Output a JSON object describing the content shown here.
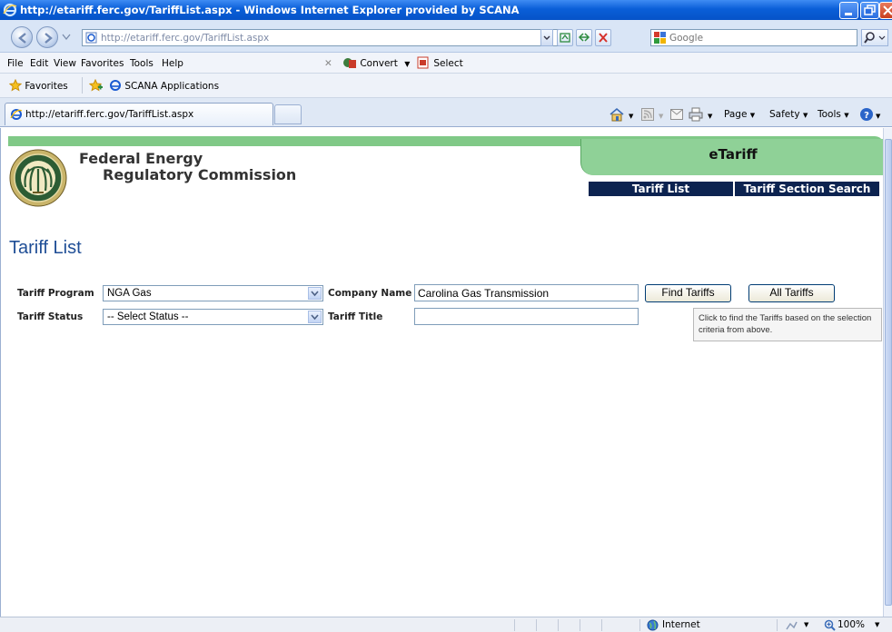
{
  "window": {
    "title": "http://etariff.ferc.gov/TariffList.aspx - Windows Internet Explorer provided by SCANA"
  },
  "address_bar": {
    "url": "http://etariff.ferc.gov/TariffList.aspx",
    "search_placeholder": "Google"
  },
  "menu": {
    "items": [
      "File",
      "Edit",
      "View",
      "Favorites",
      "Tools",
      "Help"
    ],
    "close_x": "✕",
    "convert_label": "Convert",
    "select_label": "Select"
  },
  "favorites_bar": {
    "favorites_label": "Favorites",
    "link_label": "SCANA Applications"
  },
  "tabs": {
    "active_tab": "http://etariff.ferc.gov/TariffList.aspx"
  },
  "command_bar": {
    "page_label": "Page",
    "safety_label": "Safety",
    "tools_label": "Tools"
  },
  "site": {
    "org_line1": "Federal Energy",
    "org_line2": "Regulatory Commission",
    "app_name": "eTariff",
    "nav": [
      "Tariff List",
      "Tariff Section Search"
    ]
  },
  "page": {
    "heading": "Tariff List"
  },
  "form": {
    "tariff_program_label": "Tariff Program",
    "tariff_program_value": "NGA Gas",
    "tariff_status_label": "Tariff Status",
    "tariff_status_value": "-- Select Status --",
    "company_name_label": "Company Name",
    "company_name_value": "Carolina Gas Transmission",
    "tariff_title_label": "Tariff Title",
    "tariff_title_value": "",
    "find_button": "Find Tariffs",
    "all_button": "All Tariffs",
    "tooltip": "Click to find the Tariffs based on the selection criteria from above."
  },
  "status_bar": {
    "zone": "Internet",
    "zoom": "100%"
  },
  "colors": {
    "titlebar": "#0a5fd8",
    "green_band": "#80c987",
    "navy_nav": "#0c2350",
    "heading_blue": "#1f4e96"
  }
}
